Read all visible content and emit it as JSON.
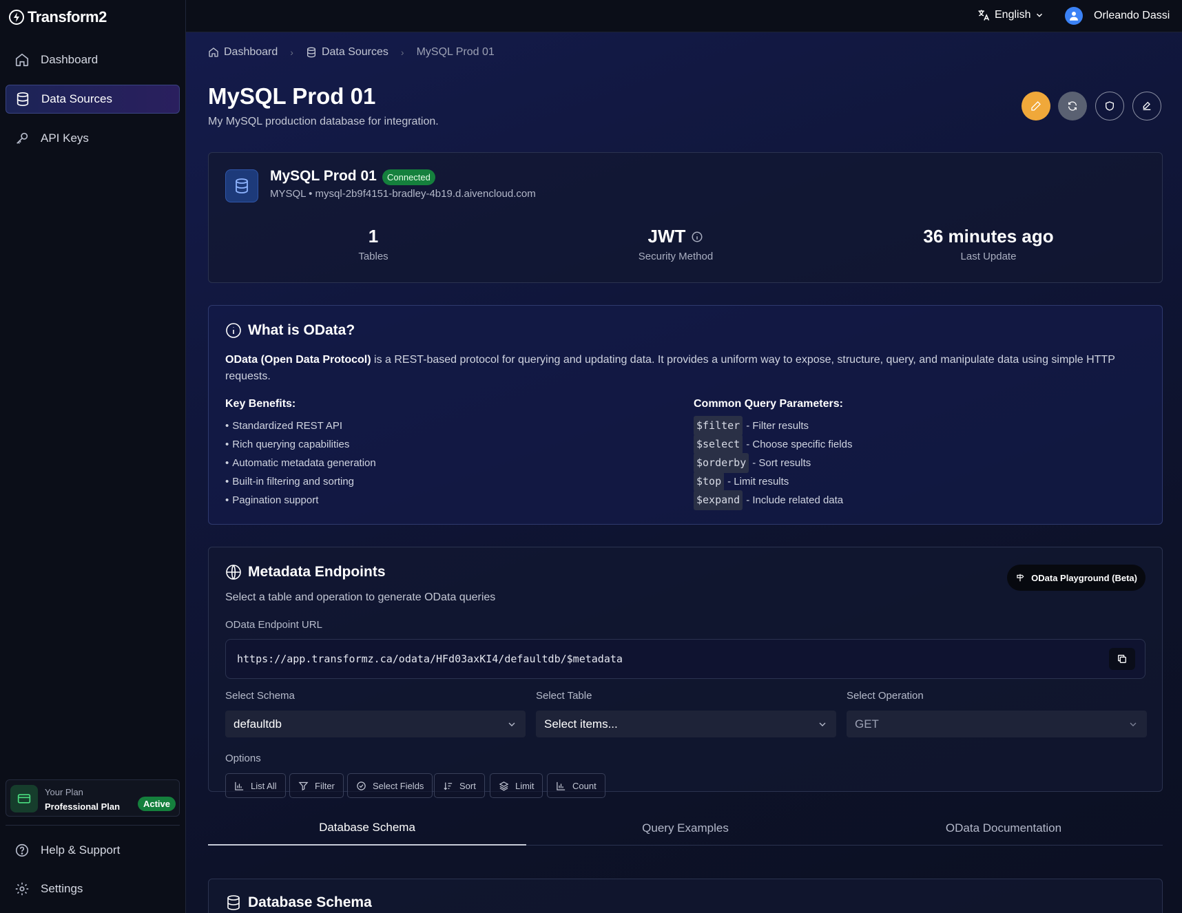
{
  "app": {
    "name": "Transform2"
  },
  "sidebar": {
    "items": [
      {
        "label": "Dashboard",
        "icon": "home-icon"
      },
      {
        "label": "Data Sources",
        "icon": "database-icon",
        "active": true
      },
      {
        "label": "API Keys",
        "icon": "key-icon"
      }
    ],
    "plan": {
      "label": "Your Plan",
      "name": "Professional Plan",
      "status": "Active"
    },
    "bottom": [
      {
        "label": "Help & Support",
        "icon": "help-circle-icon"
      },
      {
        "label": "Settings",
        "icon": "gear-icon"
      }
    ]
  },
  "topbar": {
    "language": "English",
    "user": "Orleando Dassi"
  },
  "breadcrumb": [
    "Dashboard",
    "Data Sources",
    "MySQL Prod 01"
  ],
  "page": {
    "title": "MySQL Prod 01",
    "subtitle": "My MySQL production database for integration."
  },
  "connection": {
    "name": "MySQL Prod 01",
    "status": "Connected",
    "host": "MYSQL • mysql-2b9f4151-bradley-4b19.d.aivencloud.com",
    "stats": [
      {
        "value": "1",
        "label": "Tables"
      },
      {
        "value": "JWT",
        "label": "Security Method"
      },
      {
        "value": "36 minutes ago",
        "label": "Last Update"
      }
    ]
  },
  "odata": {
    "title": "What is OData?",
    "desc_bold": "OData (Open Data Protocol)",
    "desc_rest": " is a REST-based protocol for querying and updating data. It provides a uniform way to expose, structure, query, and manipulate data using simple HTTP requests.",
    "benefits_title": "Key Benefits:",
    "benefits": [
      "Standardized REST API",
      "Rich querying capabilities",
      "Automatic metadata generation",
      "Built-in filtering and sorting",
      "Pagination support"
    ],
    "params_title": "Common Query Parameters:",
    "params": [
      {
        "code": "$filter",
        "desc": "- Filter results"
      },
      {
        "code": "$select",
        "desc": "- Choose specific fields"
      },
      {
        "code": "$orderby",
        "desc": "- Sort results"
      },
      {
        "code": "$top",
        "desc": "- Limit results"
      },
      {
        "code": "$expand",
        "desc": "- Include related data"
      }
    ]
  },
  "metadata": {
    "title": "Metadata Endpoints",
    "subtitle": "Select a table and operation to generate OData queries",
    "playground": "OData Playground (Beta)",
    "url_label": "OData Endpoint URL",
    "url": "https://app.transformz.ca/odata/HFd03axKI4/defaultdb/$metadata",
    "schema_label": "Select Schema",
    "schema_value": "defaultdb",
    "table_label": "Select Table",
    "table_value": "Select items...",
    "operation_label": "Select Operation",
    "operation_value": "GET",
    "options_label": "Options",
    "options": [
      "List All",
      "Filter",
      "Select Fields",
      "Sort",
      "Limit",
      "Count"
    ]
  },
  "tabs": [
    "Database Schema",
    "Query Examples",
    "OData Documentation"
  ],
  "schema_section": {
    "title": "Database Schema"
  },
  "colors": {
    "accent_orange": "#f0a83a",
    "connected_green": "#15803d",
    "active_nav": "#1c2456"
  }
}
